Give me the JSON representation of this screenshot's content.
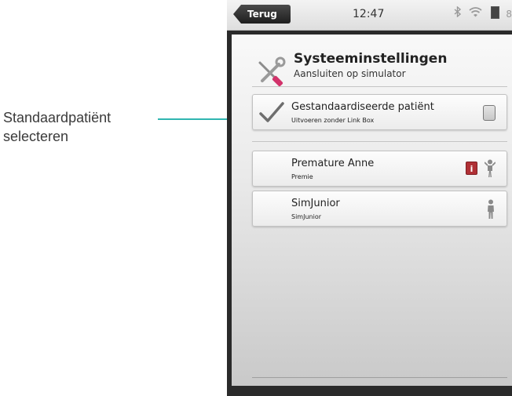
{
  "annotation": {
    "line1": "Standaardpatiënt",
    "line2": "selecteren",
    "color": "#2fb5b0"
  },
  "statusbar": {
    "back_label": "Terug",
    "time": "12:47",
    "icons": [
      "bluetooth-icon",
      "wifi-icon",
      "battery-icon"
    ],
    "battery_text": "8"
  },
  "header": {
    "title": "Systeeminstellingen",
    "subtitle": "Aansluiten op simulator",
    "icon": "wrench-screwdriver-icon"
  },
  "default_patient": {
    "title": "Gestandaardiseerde patiënt",
    "subtitle": "Uitvoeren zonder Link Box",
    "checked": true
  },
  "simulators": [
    {
      "title": "Premature Anne",
      "subtitle": "Premie",
      "badge": "i",
      "icon": "infant-figure-icon"
    },
    {
      "title": "SimJunior",
      "subtitle": "SimJunior",
      "icon": "child-figure-icon"
    }
  ],
  "colors": {
    "accent": "#2fb5b0",
    "badge": "#b03035"
  }
}
